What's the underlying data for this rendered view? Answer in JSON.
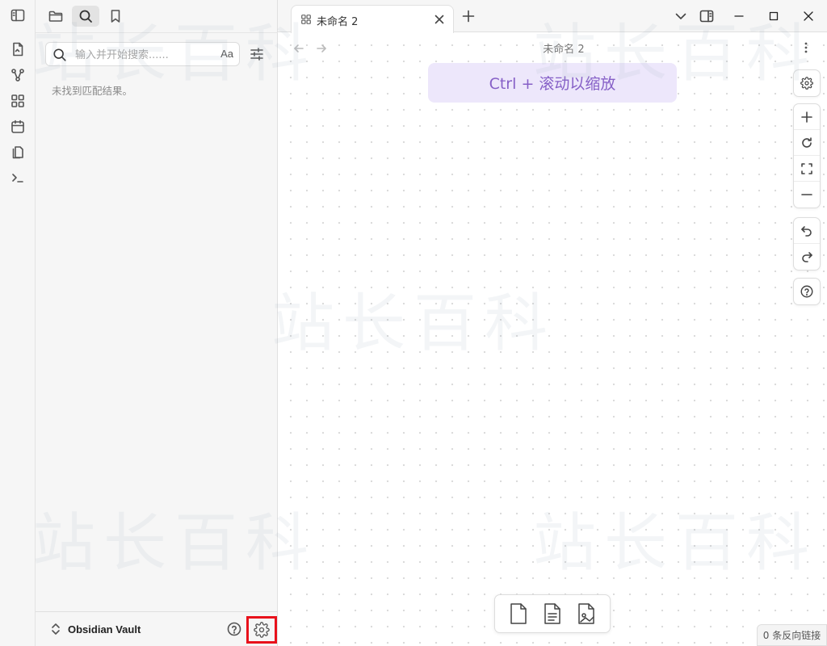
{
  "sidebar": {
    "search": {
      "placeholder": "输入并开始搜索......",
      "value": "",
      "match_case_label": "Aa"
    },
    "no_result_text": "未找到匹配结果。",
    "vault": {
      "name": "Obsidian Vault"
    }
  },
  "tab": {
    "label": "未命名 2"
  },
  "view": {
    "title": "未命名 2"
  },
  "canvas": {
    "zoom_hint": "Ctrl + 滚动以缩放"
  },
  "status_bar": {
    "backlinks": "0 条反向链接"
  },
  "watermark": {
    "text": "站长百科"
  },
  "colors": {
    "accent": "#8660c7",
    "hint_bg": "#ede7fb",
    "highlight_border": "#e8111b"
  }
}
